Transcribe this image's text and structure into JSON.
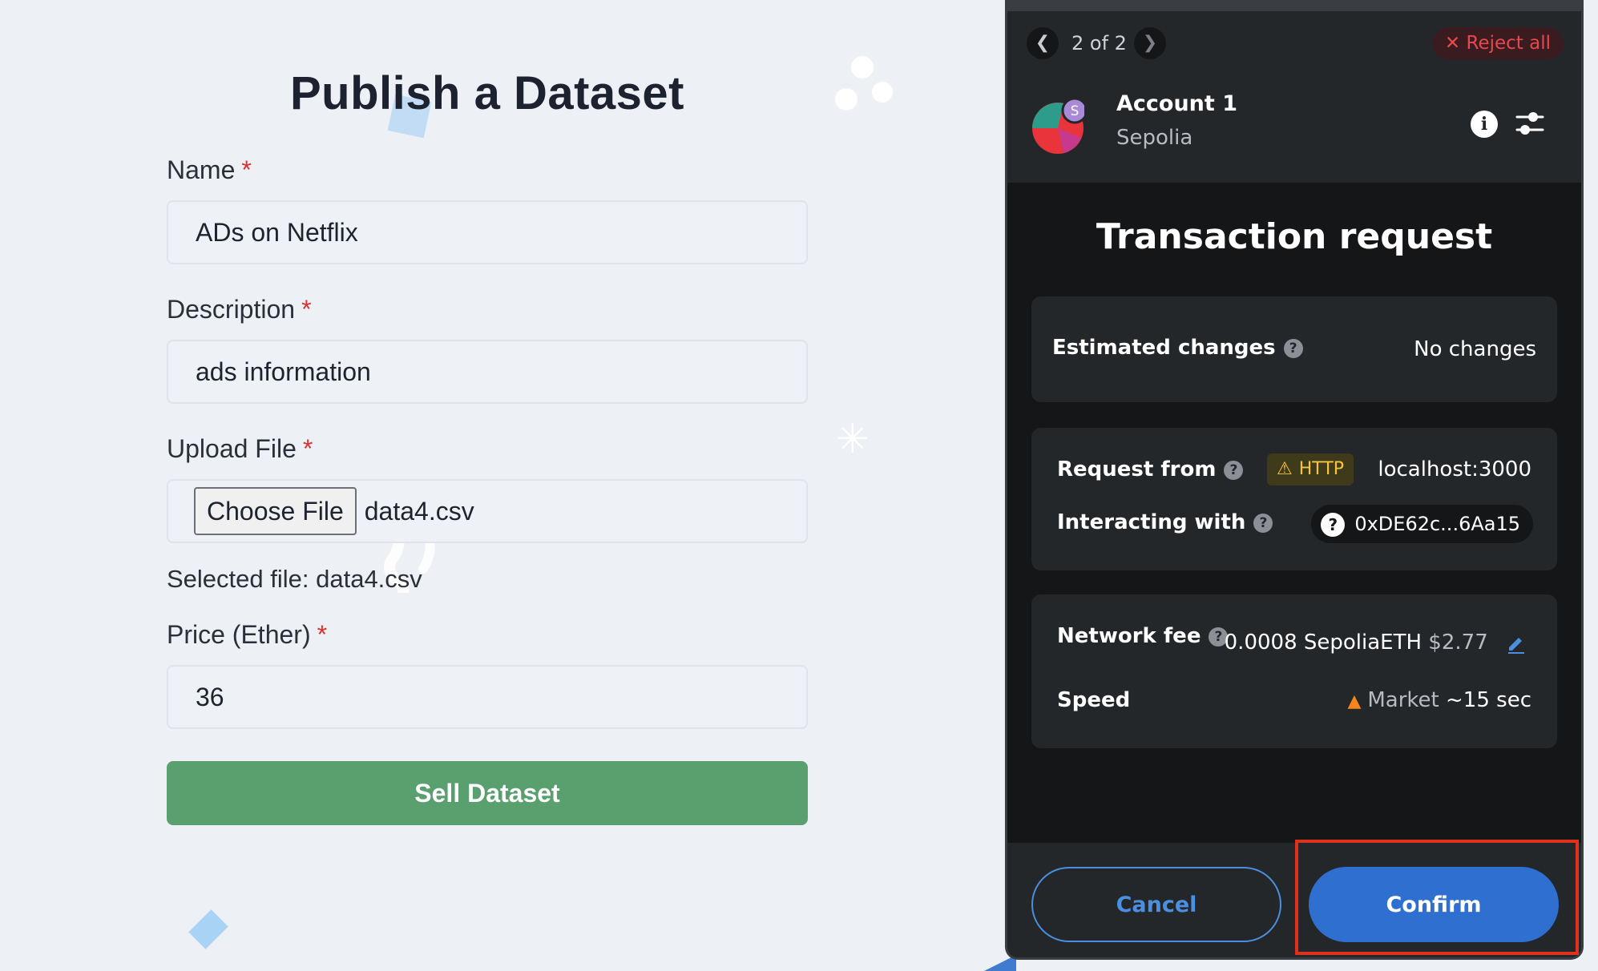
{
  "form": {
    "title": "Publish a Dataset",
    "required_mark": "*",
    "name": {
      "label": "Name",
      "value": "ADs on Netflix"
    },
    "description": {
      "label": "Description",
      "value": "ads information"
    },
    "upload": {
      "label": "Upload File",
      "button_label": "Choose File",
      "file_name": "data4.csv",
      "selected_text": "Selected file: data4.csv"
    },
    "price": {
      "label": "Price (Ether)",
      "value": "36"
    },
    "submit_label": "Sell Dataset"
  },
  "wallet": {
    "nav": {
      "prev_icon": "chevron-left-icon",
      "count": "2 of 2",
      "next_icon": "chevron-right-icon",
      "reject_all": "Reject all",
      "reject_icon": "close-icon"
    },
    "account": {
      "name": "Account 1",
      "network": "Sepolia",
      "avatar_letter": "S"
    },
    "title": "Transaction request",
    "estimated_changes": {
      "label": "Estimated changes",
      "value": "No changes"
    },
    "request_from": {
      "label": "Request from",
      "badge": "HTTP",
      "value": "localhost:3000"
    },
    "interacting_with": {
      "label": "Interacting with",
      "address_icon": "?",
      "value": "0xDE62c...6Aa15"
    },
    "network_fee": {
      "label": "Network fee",
      "amount": "0.0008 SepoliaETH",
      "fiat": "$2.77"
    },
    "speed": {
      "label": "Speed",
      "option": "Market",
      "eta": "~15 sec"
    },
    "buttons": {
      "cancel": "Cancel",
      "confirm": "Confirm"
    }
  },
  "colors": {
    "page_bg": "#edf0f5",
    "sell_button": "#5aa06f",
    "wallet_bg": "#141618",
    "wallet_card": "#24272a",
    "accent_blue": "#2f6fcf",
    "reject_red": "#e5484d",
    "highlight_red": "#e0301e"
  }
}
